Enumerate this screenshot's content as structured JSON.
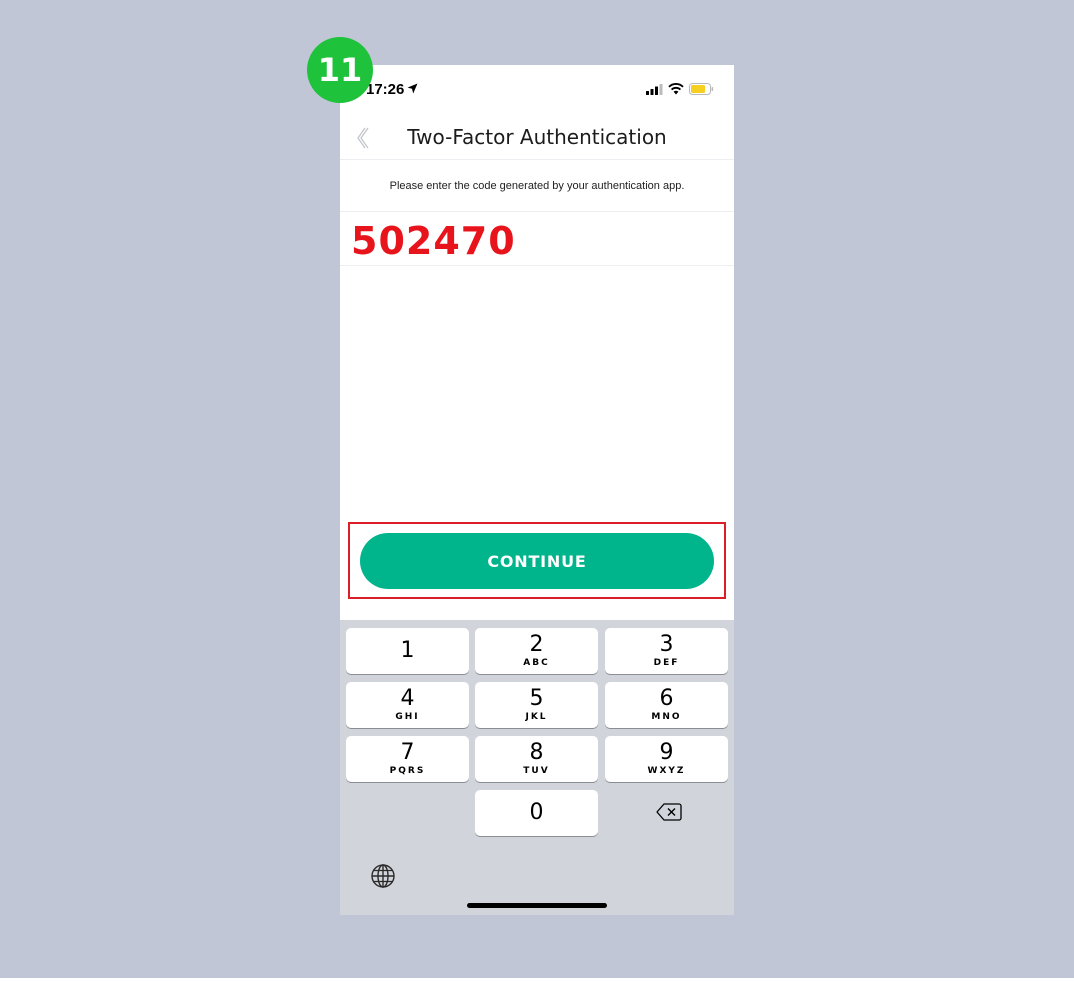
{
  "step_badge": "11",
  "status_bar": {
    "time": "17:26",
    "icons": [
      "location-arrow-icon",
      "cellular-signal-icon",
      "wifi-icon",
      "battery-icon"
    ],
    "battery_color": "#f5d020"
  },
  "nav": {
    "title": "Two-Factor Authentication",
    "back_icon": "chevron-left-icon"
  },
  "instruction": "Please enter the code generated by your authentication app.",
  "code_input": {
    "value": "502470",
    "color": "#e8141c"
  },
  "continue_button": {
    "label": "CONTINUE",
    "color": "#00b48c"
  },
  "highlight_color": "#dc1f26",
  "keyboard": {
    "keys": [
      {
        "digit": "1",
        "letters": ""
      },
      {
        "digit": "2",
        "letters": "ABC"
      },
      {
        "digit": "3",
        "letters": "DEF"
      },
      {
        "digit": "4",
        "letters": "GHI"
      },
      {
        "digit": "5",
        "letters": "JKL"
      },
      {
        "digit": "6",
        "letters": "MNO"
      },
      {
        "digit": "7",
        "letters": "PQRS"
      },
      {
        "digit": "8",
        "letters": "TUV"
      },
      {
        "digit": "9",
        "letters": "WXYZ"
      },
      {
        "digit": "0",
        "letters": ""
      }
    ],
    "backspace_icon": "backspace-icon",
    "globe_icon": "globe-icon"
  }
}
